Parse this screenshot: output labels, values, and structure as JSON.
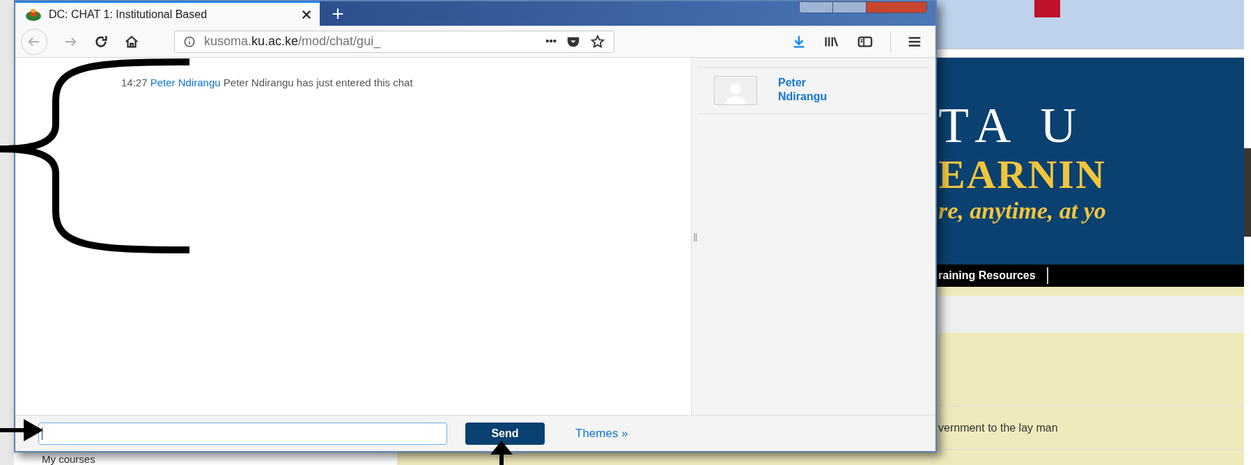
{
  "browser": {
    "tab": {
      "title": "DC: CHAT 1: Institutional Based",
      "selected": true
    },
    "new_tab": "+",
    "url": {
      "subdomain": "kusoma.",
      "domain": "ku.ac.ke",
      "path": "/mod/chat/gui_"
    },
    "more": "•••"
  },
  "chat": {
    "messages": [
      {
        "time": "14:27",
        "user": "Peter Ndirangu",
        "text": "Peter Ndirangu has just entered this chat"
      }
    ],
    "users": [
      {
        "name": "Peter Ndirangu"
      }
    ],
    "resize_handle": "‖",
    "send_button": "Send",
    "themes_link": "Themes »"
  },
  "background_page": {
    "banner": {
      "line_1": "TA U",
      "line_2": "EARNIN",
      "tagline": "re, anytime, at yo"
    },
    "nav_item": "raining Resources",
    "row_text": "vernment to the lay man",
    "sidebar_item": "My courses"
  }
}
